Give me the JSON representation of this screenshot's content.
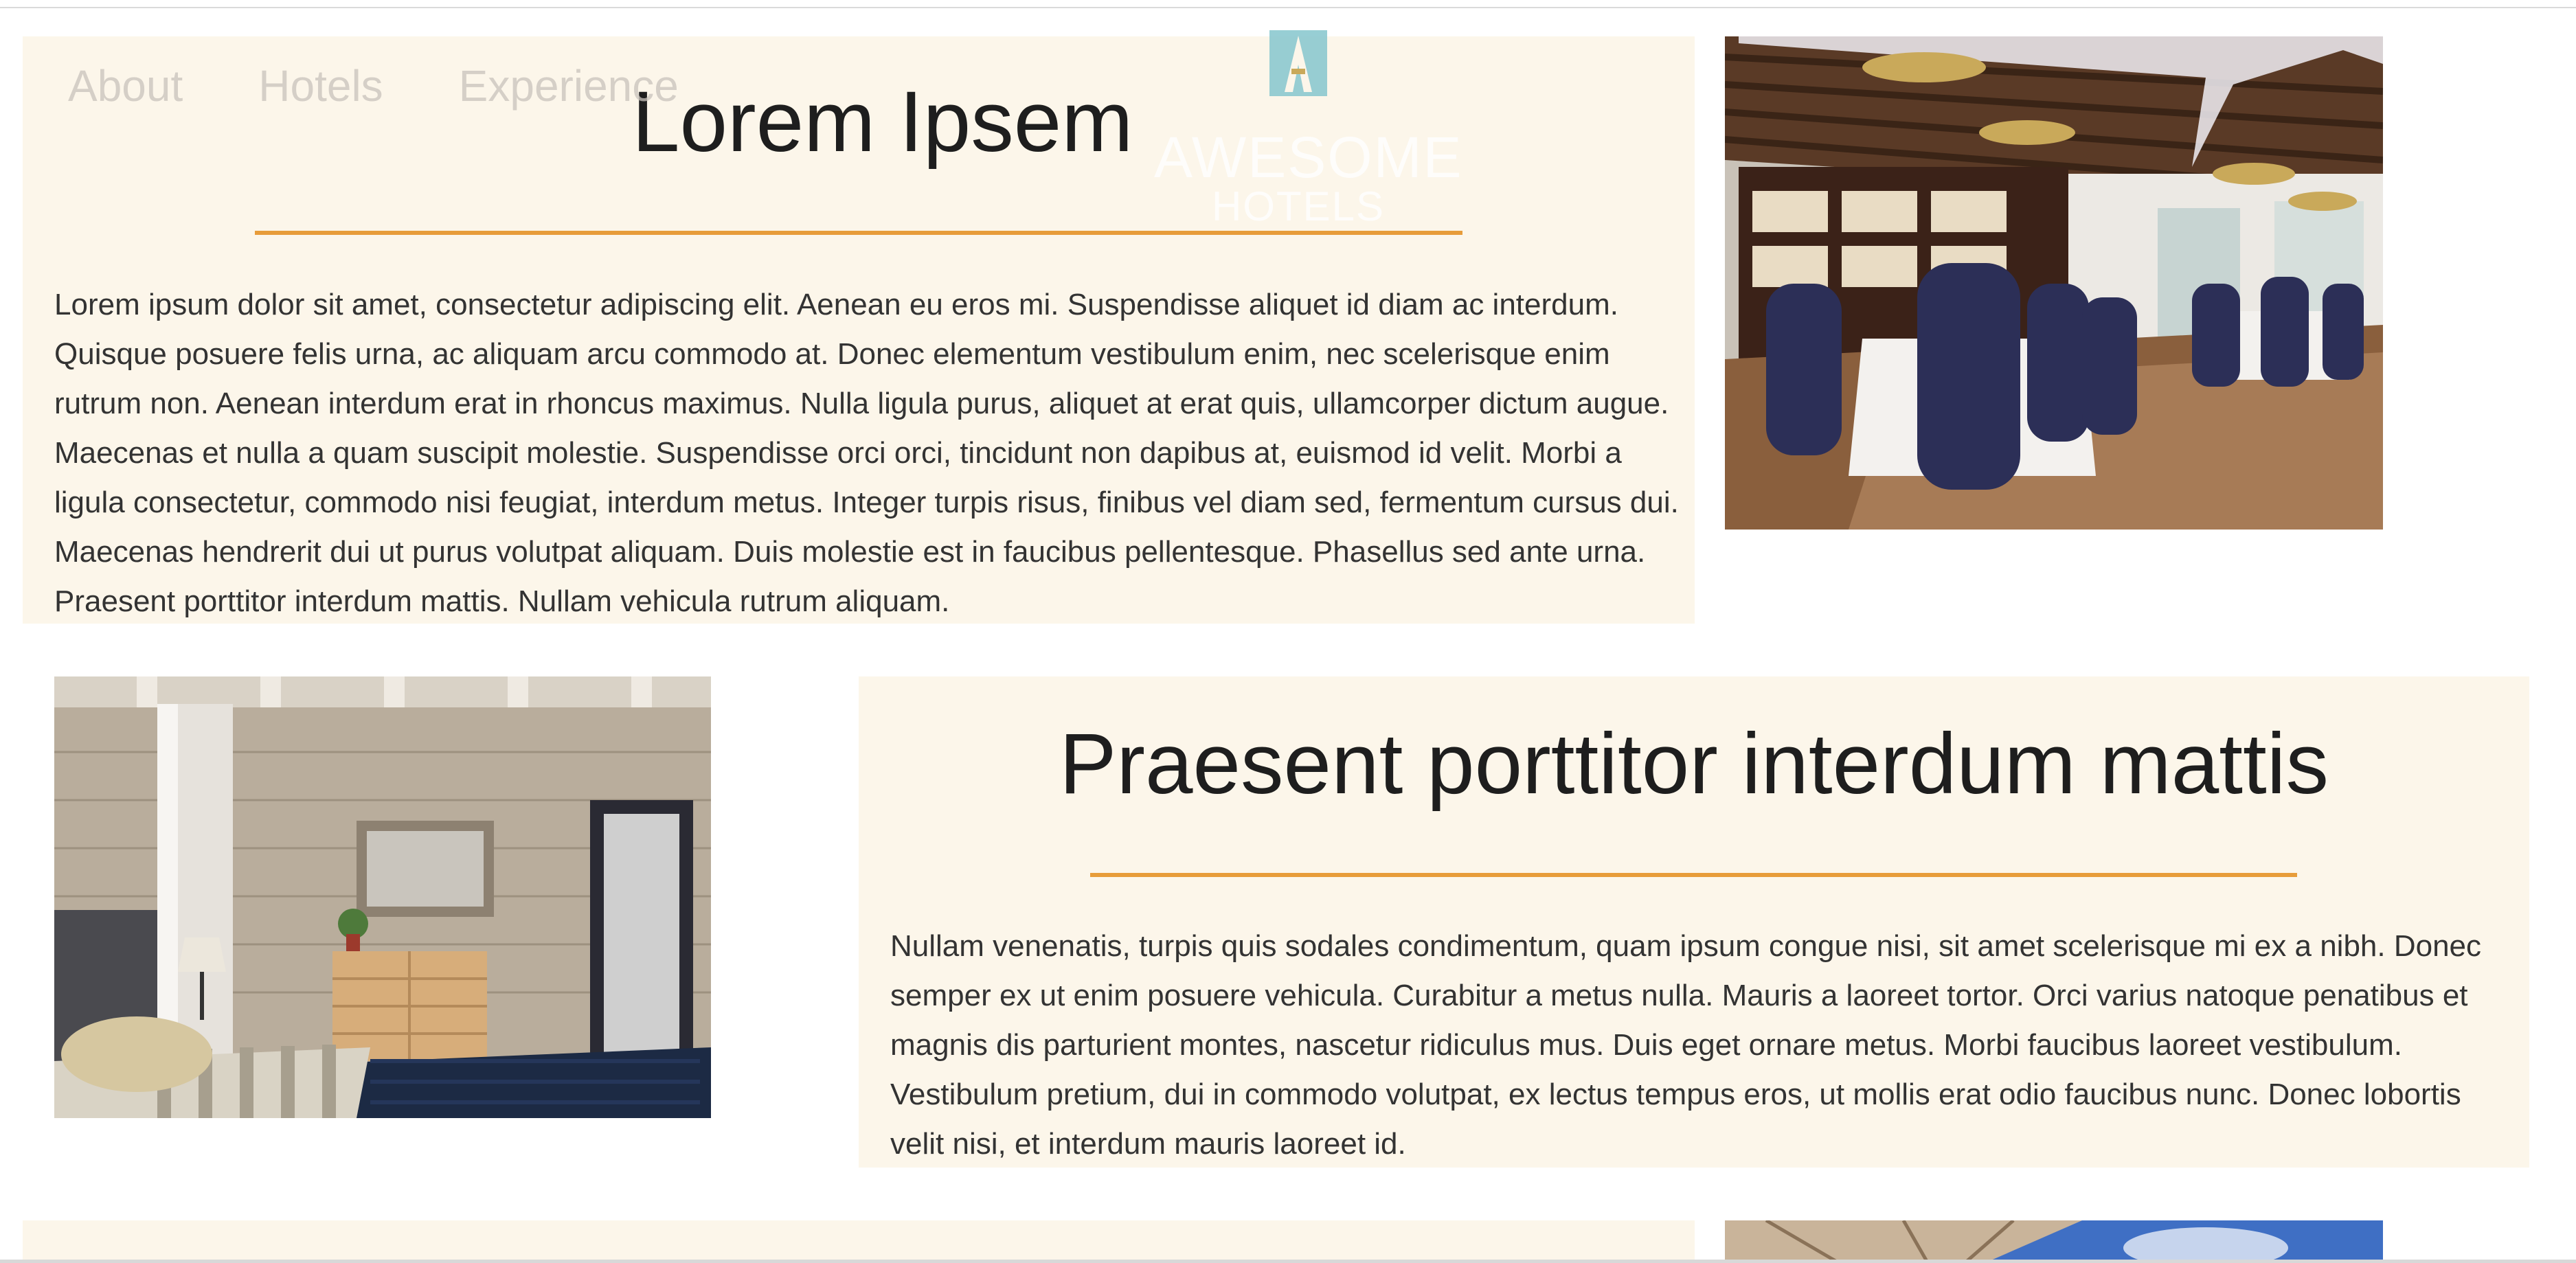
{
  "nav": {
    "items": [
      {
        "label": "About"
      },
      {
        "label": "Hotels"
      },
      {
        "label": "Experience"
      }
    ]
  },
  "logo": {
    "line1": "AWESOME",
    "line2": "HOTELS",
    "icon": "letter-a-tower-icon"
  },
  "sections": [
    {
      "title": "Lorem Ipsem",
      "body": "Lorem ipsum dolor sit amet, consectetur adipiscing elit. Aenean eu eros mi. Suspendisse aliquet id diam ac interdum. Quisque posuere felis urna, ac aliquam arcu commodo at. Donec elementum vestibulum enim, nec scelerisque enim rutrum non. Aenean interdum erat in rhoncus maximus. Nulla ligula purus, aliquet at erat quis, ullamcorper dictum augue. Maecenas et nulla a quam suscipit molestie. Suspendisse orci orci, tincidunt non dapibus at, euismod id velit. Morbi a ligula consectetur, commodo nisi feugiat, interdum metus. Integer turpis risus, finibus vel diam sed, fermentum cursus dui. Maecenas hendrerit dui ut purus volutpat aliquam. Duis molestie est in faucibus pellentesque. Phasellus sed ante urna. Praesent porttitor interdum mattis. Nullam vehicula rutrum aliquam.",
      "image": "restaurant-dining-room-photo"
    },
    {
      "title": "Praesent porttitor interdum mattis",
      "body": "Nullam venenatis, turpis quis sodales condimentum, quam ipsum congue nisi, sit amet scelerisque mi ex a nibh. Donec semper ex ut enim posuere vehicula. Curabitur a metus nulla. Mauris a laoreet tortor. Orci varius natoque penatibus et magnis dis parturient montes, nascetur ridiculus mus. Duis eget ornare metus. Morbi faucibus laoreet vestibulum. Vestibulum pretium, dui in commodo volutpat, ex lectus tempus eros, ut mollis erat odio faucibus nunc. Donec lobortis velit nisi, et interdum mauris laoreet id.",
      "image": "hotel-bedroom-photo"
    },
    {
      "image": "umbrella-sky-photo"
    }
  ],
  "colors": {
    "panel_bg": "#fcf6ea",
    "accent_rule": "#e79c3a",
    "nav_text": "#c9c3bc",
    "logo_mark": "#8cc9cf"
  }
}
